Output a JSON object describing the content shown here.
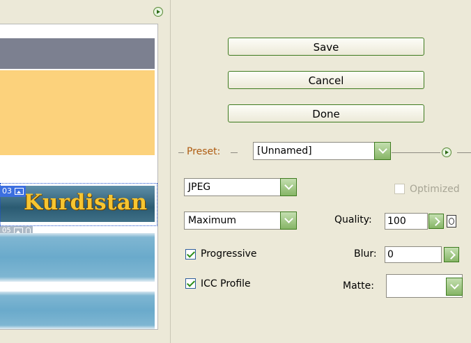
{
  "buttons": {
    "save": "Save",
    "cancel": "Cancel",
    "done": "Done"
  },
  "preview": {
    "banner_text": "Kurdistan",
    "slice_03": "03",
    "slice_05": "05"
  },
  "preset": {
    "label": "Preset:",
    "value": "[Unnamed]"
  },
  "format": {
    "value": "JPEG"
  },
  "optimized": {
    "label": "Optimized",
    "checked": false
  },
  "compression": {
    "value": "Maximum"
  },
  "quality": {
    "label": "Quality:",
    "value": "100"
  },
  "progressive": {
    "label": "Progressive",
    "checked": true
  },
  "blur": {
    "label": "Blur:",
    "value": "0"
  },
  "icc_profile": {
    "label": "ICC Profile",
    "checked": true
  },
  "matte": {
    "label": "Matte:",
    "value": ""
  },
  "colors": {
    "accent_green": "#3d7a1e",
    "preset_label": "#ae5b10",
    "slice_blue": "#3c6fe0"
  }
}
